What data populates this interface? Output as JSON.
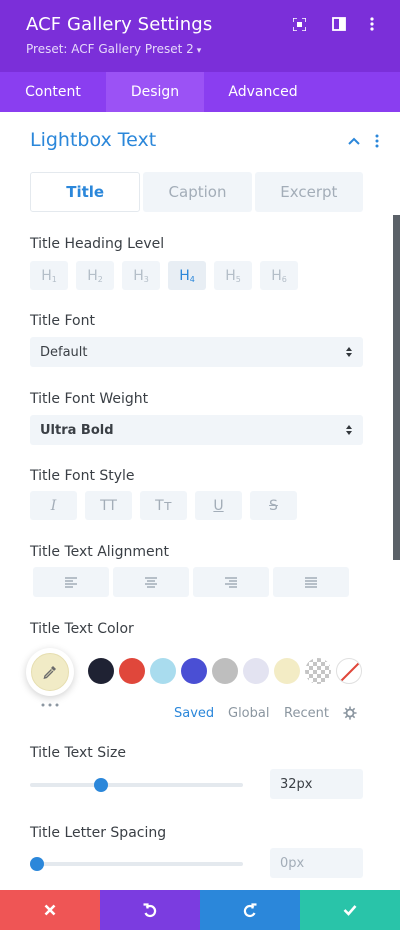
{
  "header": {
    "title": "ACF Gallery Settings",
    "preset": "Preset: ACF Gallery Preset 2",
    "bg_color": "#7b2fd9",
    "icons": [
      "focus-icon",
      "split-view-icon",
      "kebab-menu-icon"
    ]
  },
  "tabs": [
    {
      "label": "Content",
      "active": false
    },
    {
      "label": "Design",
      "active": true
    },
    {
      "label": "Advanced",
      "active": false
    }
  ],
  "section": {
    "title": "Lightbox Text",
    "subtabs": [
      {
        "label": "Title",
        "active": true
      },
      {
        "label": "Caption",
        "active": false
      },
      {
        "label": "Excerpt",
        "active": false
      }
    ]
  },
  "heading_level": {
    "label": "Title Heading Level",
    "options": [
      {
        "main": "H",
        "sub": "1"
      },
      {
        "main": "H",
        "sub": "2"
      },
      {
        "main": "H",
        "sub": "3"
      },
      {
        "main": "H",
        "sub": "4"
      },
      {
        "main": "H",
        "sub": "5"
      },
      {
        "main": "H",
        "sub": "6"
      }
    ],
    "selected": "H4"
  },
  "font": {
    "label": "Title Font",
    "value": "Default"
  },
  "font_weight": {
    "label": "Title Font Weight",
    "value": "Ultra Bold"
  },
  "font_style": {
    "label": "Title Font Style",
    "options": [
      "I",
      "TT",
      "Tт",
      "U",
      "S"
    ]
  },
  "alignment": {
    "label": "Title Text Alignment",
    "options": [
      "align-left-icon",
      "align-center-icon",
      "align-right-icon",
      "align-justify-icon"
    ]
  },
  "color": {
    "label": "Title Text Color",
    "current": "#f1ebc6",
    "swatches": [
      "#1f2233",
      "#e0473b",
      "#a9dcee",
      "#4a4fd4",
      "#bebebe",
      "#e3e3f1",
      "#f3ecc5",
      "transparent",
      "none"
    ],
    "palette_tabs": [
      {
        "label": "Saved",
        "active": true
      },
      {
        "label": "Global",
        "active": false
      },
      {
        "label": "Recent",
        "active": false
      }
    ]
  },
  "text_size": {
    "label": "Title Text Size",
    "value": "32px",
    "slider_fraction": 0.32
  },
  "letter_spacing": {
    "label": "Title Letter Spacing",
    "value": "0px",
    "slider_fraction": 0.0
  },
  "actions": [
    {
      "name": "discard",
      "color": "#ef5555"
    },
    {
      "name": "undo",
      "color": "#7b3ce0"
    },
    {
      "name": "redo",
      "color": "#2b87da"
    },
    {
      "name": "save",
      "color": "#29c4a9"
    }
  ]
}
